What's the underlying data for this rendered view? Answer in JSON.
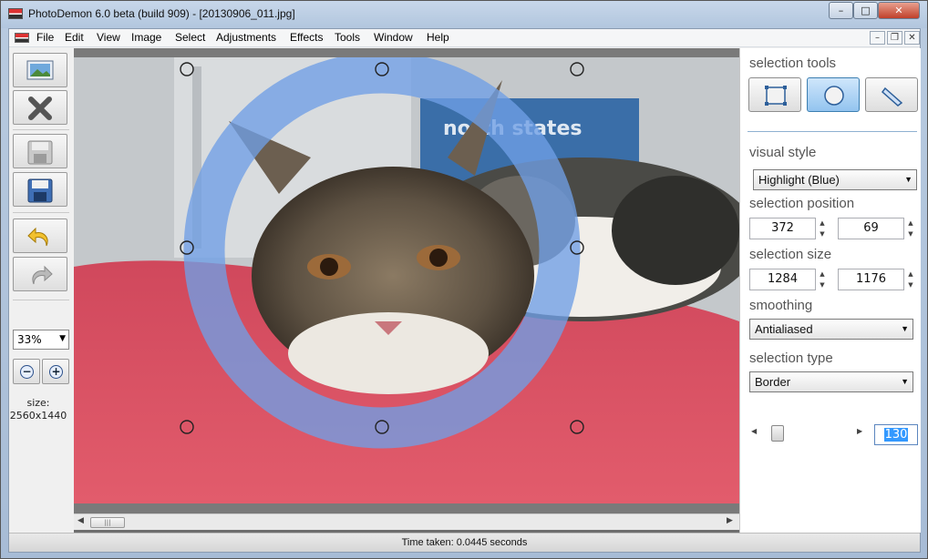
{
  "window": {
    "title": "PhotoDemon 6.0 beta (build 909) - [20130906_011.jpg]",
    "controls": {
      "minimize": "–",
      "maximize": "□",
      "close": "✕"
    }
  },
  "menu": {
    "items": [
      "File",
      "Edit",
      "View",
      "Image",
      "Select",
      "Adjustments",
      "Effects",
      "Tools",
      "Window",
      "Help"
    ],
    "mdi": {
      "minimize": "–",
      "restore": "❐",
      "close": "✕"
    }
  },
  "left_panel": {
    "tools": [
      "open-image",
      "close-image",
      "save",
      "save-as",
      "undo",
      "redo"
    ],
    "zoom": "33%",
    "zoom_out": "−",
    "zoom_in": "+",
    "size_label": "size:",
    "size_value": "2560x1440"
  },
  "right_panel": {
    "selection_tools_label": "selection tools",
    "selection_tools": [
      {
        "name": "rectangle",
        "active": false
      },
      {
        "name": "ellipse",
        "active": true
      },
      {
        "name": "line",
        "active": false
      }
    ],
    "visual_style_label": "visual style",
    "visual_style": "Highlight (Blue)",
    "selection_position_label": "selection position",
    "position_x": "372",
    "position_y": "69",
    "selection_size_label": "selection size",
    "size_w": "1284",
    "size_h": "1176",
    "smoothing_label": "smoothing",
    "smoothing": "Antialiased",
    "selection_type_label": "selection type",
    "selection_type": "Border",
    "border_width": "130"
  },
  "status": {
    "text": "Time taken: 0.0445 seconds"
  },
  "colors": {
    "selection_highlight": "#6f9fe6",
    "accent_active": "#93c4ef"
  }
}
